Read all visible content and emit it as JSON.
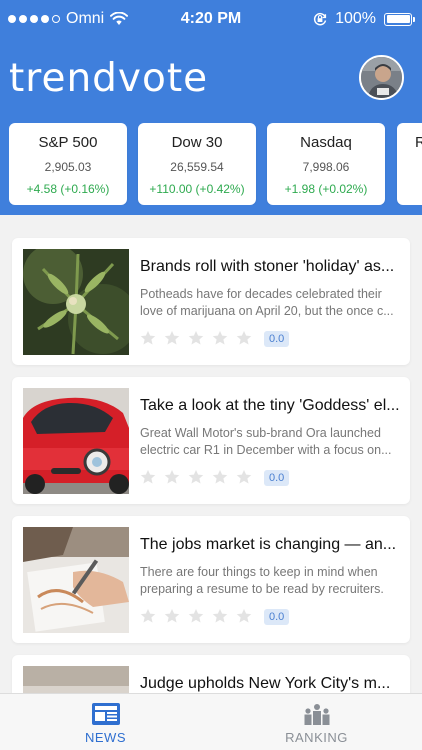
{
  "status_bar": {
    "carrier": "Omni",
    "time": "4:20 PM",
    "battery": "100%",
    "battery_level": 1.0
  },
  "app": {
    "title": "trendvote"
  },
  "colors": {
    "brand": "#3f7fdc",
    "positive": "#2eaa4f",
    "active_tab": "#2f6fd0",
    "inactive_tab": "#8a8f96"
  },
  "tickers": [
    {
      "name": "S&P 500",
      "value": "2,905.03",
      "change": "+4.58 (+0.16%)"
    },
    {
      "name": "Dow 30",
      "value": "26,559.54",
      "change": "+110.00 (+0.42%)"
    },
    {
      "name": "Nasdaq",
      "value": "7,998.06",
      "change": "+1.98 (+0.02%)"
    },
    {
      "name": "R",
      "value": "",
      "change": ""
    }
  ],
  "articles": [
    {
      "title": "Brands roll with stoner 'holiday' as...",
      "excerpt_line1": "Potheads have for decades celebrated their",
      "excerpt_line2": "love of marijuana on April 20, but the once c...",
      "rating": 0,
      "score": "0.0",
      "image": "cannabis-plant"
    },
    {
      "title": "Take a look at the tiny 'Goddess' el...",
      "excerpt_line1": "Great Wall Motor's sub-brand Ora launched",
      "excerpt_line2": "electric car R1 in December with a focus on...",
      "rating": 0,
      "score": "0.0",
      "image": "red-electric-car"
    },
    {
      "title": "The jobs market is changing — an...",
      "excerpt_line1": "There are four things to keep in mind when",
      "excerpt_line2": "preparing a resume to be read by recruiters.",
      "rating": 0,
      "score": "0.0",
      "image": "hand-writing"
    },
    {
      "title": "Judge upholds New York City's m...",
      "excerpt_line1": "",
      "excerpt_line2": "",
      "rating": 0,
      "score": "",
      "image": "partial"
    }
  ],
  "tabs": [
    {
      "label": "NEWS",
      "icon": "newspaper-icon",
      "active": true
    },
    {
      "label": "RANKING",
      "icon": "ranking-icon",
      "active": false
    }
  ]
}
